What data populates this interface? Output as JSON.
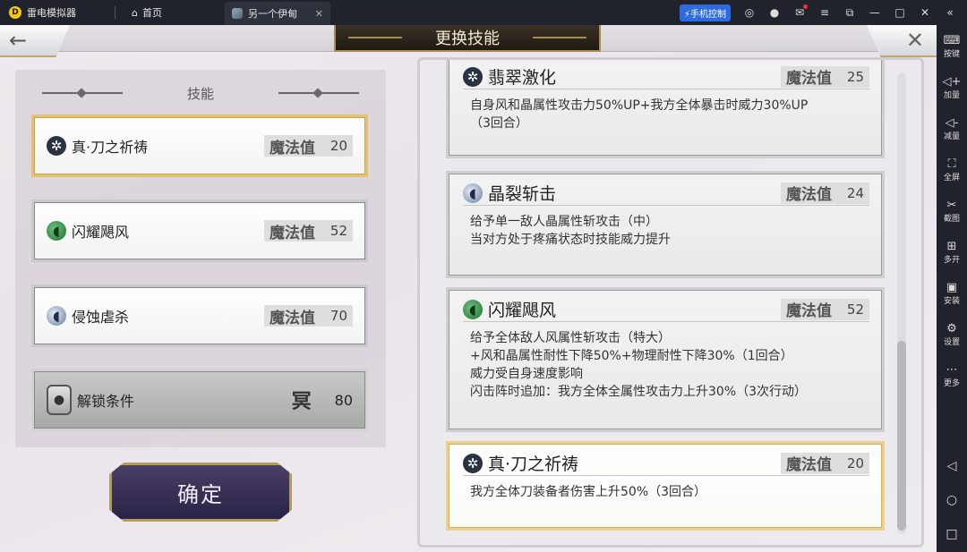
{
  "emulator": {
    "app_name": "雷电模拟器",
    "home_tab": "首页",
    "game_tab": "另一个伊甸",
    "phone_control": "手机控制"
  },
  "sidebar": {
    "items": [
      {
        "icon": "keyboard-icon",
        "glyph": "⌨",
        "label": "按键"
      },
      {
        "icon": "volume-up-icon",
        "glyph": "◁+",
        "label": "加量"
      },
      {
        "icon": "volume-down-icon",
        "glyph": "◁-",
        "label": "减量"
      },
      {
        "icon": "fullscreen-icon",
        "glyph": "⛶",
        "label": "全屏"
      },
      {
        "icon": "scissors-icon",
        "glyph": "✂",
        "label": "截图"
      },
      {
        "icon": "multi-open-icon",
        "glyph": "⊞",
        "label": "多开"
      },
      {
        "icon": "apk-icon",
        "glyph": "▣",
        "label": "安装"
      },
      {
        "icon": "settings-icon",
        "glyph": "⚙",
        "label": "设置"
      },
      {
        "icon": "more-icon",
        "glyph": "⋯",
        "label": "更多"
      }
    ]
  },
  "game": {
    "title": "更换技能",
    "back_glyph": "←",
    "close_glyph": "✕",
    "skills_header": "技能",
    "confirm_label": "确定",
    "mp_label": "魔法值",
    "slots": [
      {
        "name": "真·刀之祈祷",
        "mp": "20",
        "icon": "blade-skill-icon",
        "glyph": "✲"
      },
      {
        "name": "闪耀飓风",
        "mp": "52",
        "icon": "wind-skill-icon",
        "glyph": "◖"
      },
      {
        "name": "侵蚀虐杀",
        "mp": "70",
        "icon": "crystal-skill-icon",
        "glyph": "◖"
      }
    ],
    "locked_slot": {
      "name": "解锁条件",
      "rank": "冥",
      "value": "80"
    },
    "cards": [
      {
        "name": "翡翠激化",
        "mp": "25",
        "icon": "blade-skill-icon",
        "glyph": "✲",
        "lines": [
          "自身风和晶属性攻击力50%UP+我方全体暴击时威力30%UP",
          "（3回合）"
        ]
      },
      {
        "name": "晶裂斩击",
        "mp": "24",
        "icon": "crystal-skill-icon",
        "glyph": "◖",
        "lines": [
          "给予单一敌人晶属性斩攻击（中）",
          "当对方处于疼痛状态时技能威力提升"
        ]
      },
      {
        "name": "闪耀飓风",
        "mp": "52",
        "icon": "wind-skill-icon",
        "glyph": "◖",
        "lines": [
          "给予全体敌人风属性斩攻击（特大）",
          "+风和晶属性耐性下降50%+物理耐性下降30%（1回合）",
          "威力受自身速度影响",
          "闪击阵时追加：我方全体全属性攻击力上升30%（3次行动）"
        ]
      },
      {
        "name": "真·刀之祈祷",
        "mp": "20",
        "icon": "blade-skill-icon",
        "glyph": "✲",
        "lines": [
          "我方全体刀装备者伤害上升50%（3回合）"
        ]
      }
    ]
  }
}
